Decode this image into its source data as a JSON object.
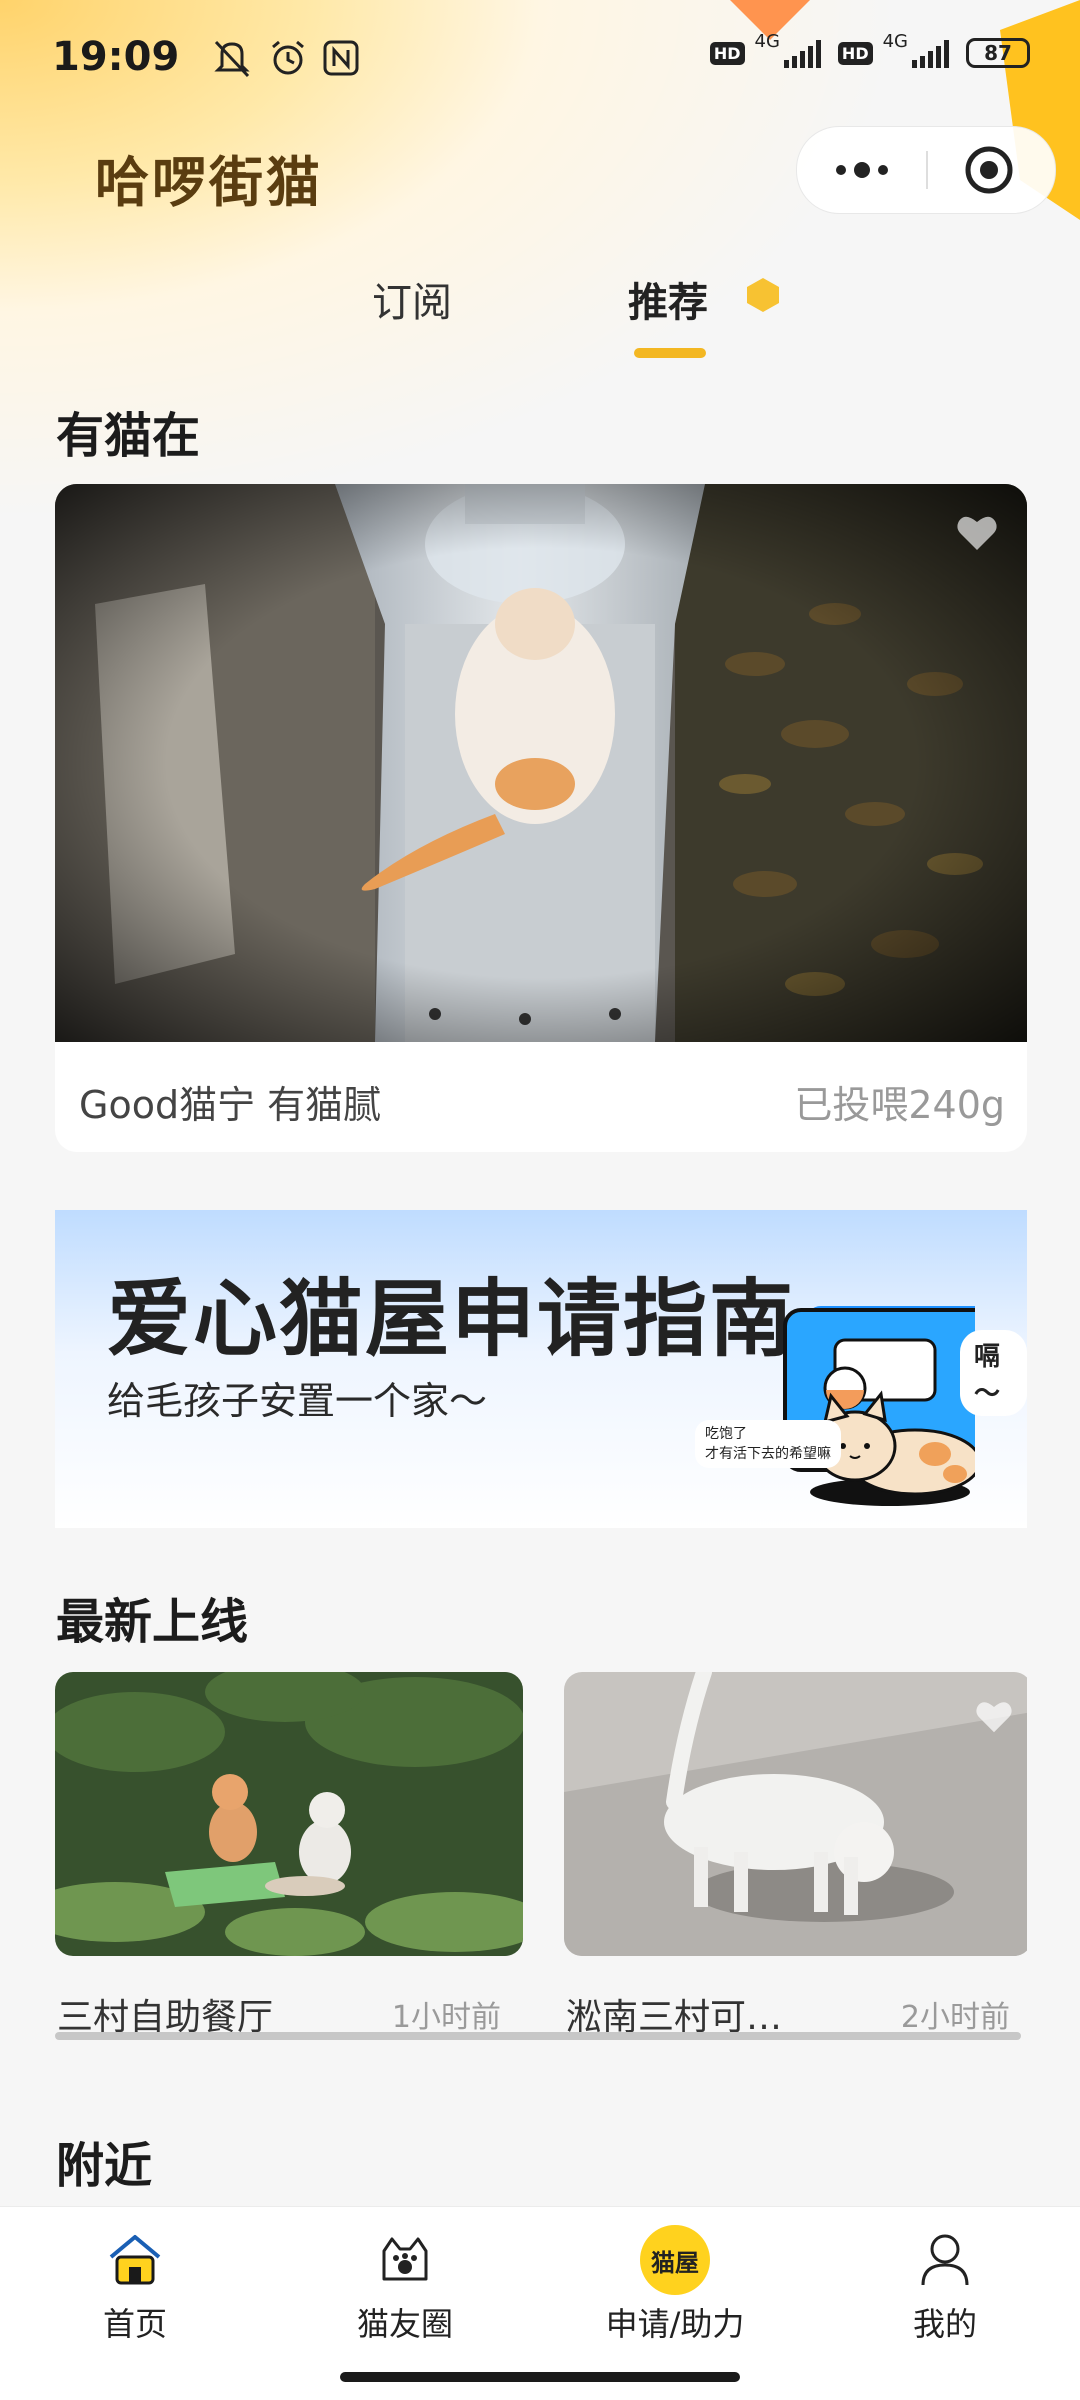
{
  "status_bar": {
    "time": "19:09",
    "icons": [
      "mute-icon",
      "alarm-icon",
      "nfc-icon"
    ],
    "hd1": "HD",
    "net1": "4G",
    "hd2": "HD",
    "net2": "4G",
    "battery": "87"
  },
  "app": {
    "title": "哈啰街猫"
  },
  "tabs": [
    {
      "label": "订阅",
      "active": false
    },
    {
      "label": "推荐",
      "active": true
    }
  ],
  "sections": {
    "live": "有猫在",
    "newest": "最新上线",
    "nearby": "附近"
  },
  "live_card": {
    "station": "Good猫宁 有猫腻",
    "fed": "已投喂240g"
  },
  "banner": {
    "title": "爱心猫屋申请指南",
    "subtitle": "给毛孩子安置一个家～",
    "bubble_meow": "嗝～",
    "bubble_small_1": "吃饱了",
    "bubble_small_2": "才有活下去的希望嘛"
  },
  "new_items": [
    {
      "name": "三村自助餐厅",
      "time": "1小时前"
    },
    {
      "name": "淞南三村可…",
      "time": "2小时前"
    }
  ],
  "tabbar": [
    {
      "label": "首页",
      "icon": "home-icon"
    },
    {
      "label": "猫友圈",
      "icon": "cat-paw-icon"
    },
    {
      "label": "申请/助力",
      "icon": "cat-house-icon",
      "badge_text": "猫屋"
    },
    {
      "label": "我的",
      "icon": "user-icon"
    }
  ],
  "colors": {
    "accent": "#f3b722",
    "brand_text": "#5a3d10",
    "catroom_badge": "#ffd21e"
  }
}
